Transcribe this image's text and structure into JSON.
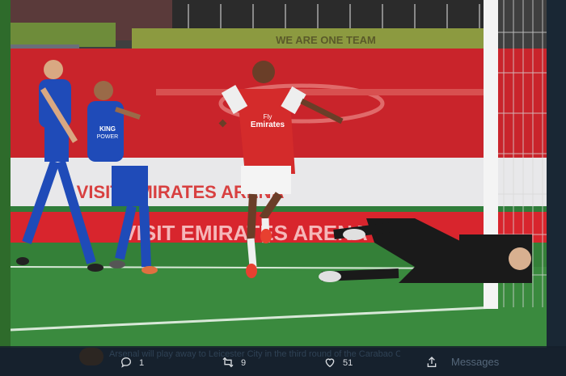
{
  "photo": {
    "alt_subject": "football-goal-celebration",
    "banner_top": "WE ARE ONE TEAM",
    "banner_middle": "VISIT EMIRATES ARENA",
    "banner_bottom": "VISIT EMIRATES ARENA",
    "red_shirt_sponsor_line1": "Fly",
    "red_shirt_sponsor_line2": "Emirates",
    "blue_shirt_sponsor_line1": "KING",
    "blue_shirt_sponsor_line2": "POWER",
    "colors": {
      "pitch": "#3a8a3e",
      "stand_red": "#c8242b",
      "home_kit": "#d42b2b",
      "away_kit": "#1f4bb8",
      "keeper_kit": "#1a1a1a"
    }
  },
  "caption": {
    "text": "Arsenal will play away to Leicester City in the third round of the Carabao Cup"
  },
  "actions": {
    "reply_count": "1",
    "retweet_count": "9",
    "like_count": "51",
    "messages_label": "Messages"
  }
}
